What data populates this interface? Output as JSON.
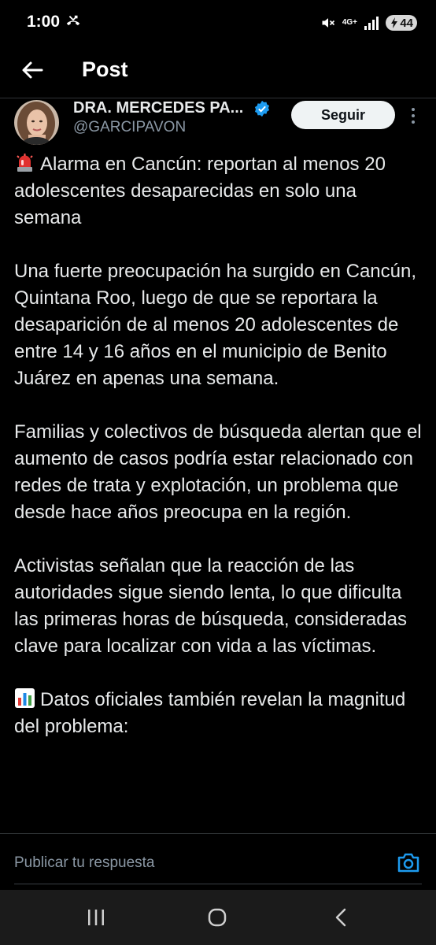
{
  "status_bar": {
    "time": "1:00",
    "network": "4G+",
    "battery": "44"
  },
  "header": {
    "title": "Post"
  },
  "post": {
    "author_name": "DRA. MERCEDES PA...",
    "author_handle": "@GARCIPAVON",
    "follow_label": "Seguir",
    "paragraphs": [
      {
        "emoji": "rotating-light-icon",
        "text": "Alarma en Cancún: reportan al menos 20 adolescentes desaparecidas en solo una semana"
      },
      {
        "text": "Una fuerte preocupación ha surgido en Cancún, Quintana Roo, luego de que se reportara la desaparición de al menos 20 adolescentes de entre 14 y 16 años en el municipio de Benito Juárez en apenas una semana."
      },
      {
        "text": "Familias y colectivos de búsqueda alertan que el aumento de casos podría estar relacionado con redes de trata y explotación, un problema que desde hace años preocupa en la región."
      },
      {
        "text": "Activistas señalan que la reacción de las autoridades sigue siendo lenta, lo que dificulta las primeras horas de búsqueda, consideradas clave para localizar con vida a las víctimas."
      },
      {
        "emoji": "bar-chart-icon",
        "text": "Datos oficiales también revelan la magnitud del problema:"
      }
    ]
  },
  "reply": {
    "placeholder": "Publicar tu respuesta"
  },
  "colors": {
    "background": "#000000",
    "text": "#e7e9ea",
    "secondary": "#8b98a5",
    "accent": "#1d9bf0"
  }
}
